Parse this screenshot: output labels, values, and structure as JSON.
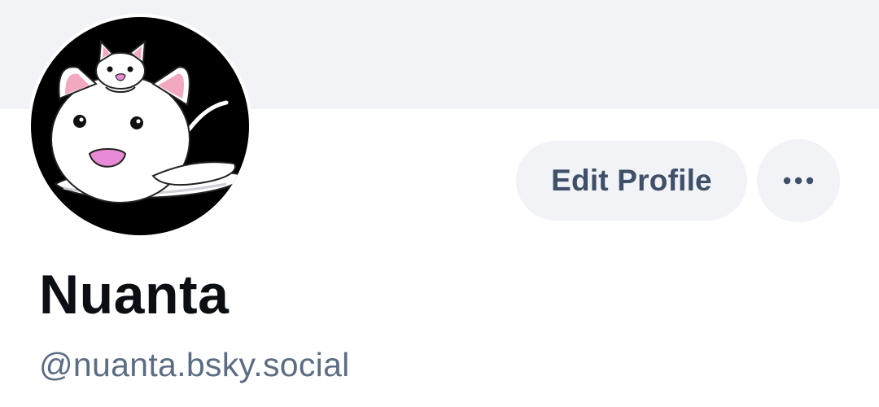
{
  "profile": {
    "display_name": "Nuanta",
    "handle": "@nuanta.bsky.social"
  },
  "actions": {
    "edit_profile_label": "Edit Profile",
    "more_icon": "more-horizontal-icon"
  },
  "avatar": {
    "description_icon": "cat-avatar-icon"
  },
  "colors": {
    "banner": "#f1f3f6",
    "button_bg": "#f1f3f6",
    "button_text": "#3f5068",
    "name_text": "#0b0f14",
    "handle_text": "#5c6d83"
  }
}
